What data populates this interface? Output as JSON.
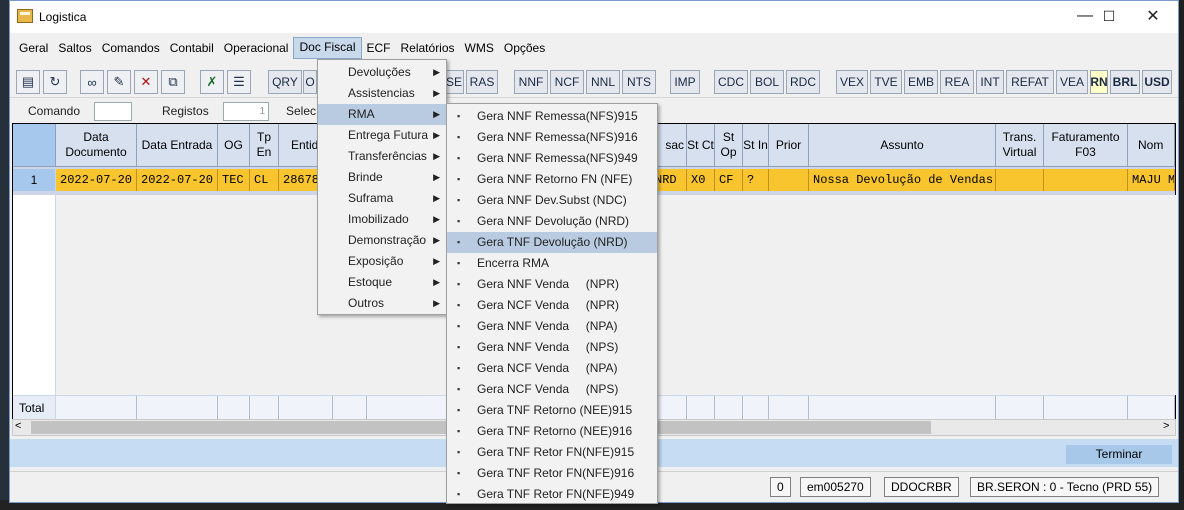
{
  "window": {
    "title": "Logistica",
    "minimize": "—",
    "maximize": "☐",
    "close": "✕"
  },
  "menubar": [
    "Geral",
    "Saltos",
    "Comandos",
    "Contabil",
    "Operacional",
    "Doc Fiscal",
    "ECF",
    "Relatórios",
    "WMS",
    "Opções"
  ],
  "toolbar": {
    "icons": [
      "folder-filter-icon",
      "refresh-icon",
      "glasses-icon",
      "edit-icon",
      "delete-icon",
      "copy-icon",
      "excel-icon",
      "report-icon"
    ],
    "buttons": [
      "QRY",
      "O",
      "SE",
      "RAS",
      "NNF",
      "NCF",
      "NNL",
      "NTS",
      "IMP",
      "CDC",
      "BOL",
      "RDC",
      "VEX",
      "TVE",
      "EMB",
      "REA",
      "INT",
      "REFAT",
      "VEA",
      "RN",
      "BRL",
      "USD"
    ]
  },
  "command_row": {
    "comando_label": "Comando",
    "registos_label": "Registos",
    "registos_value": "1",
    "selec_label": "Selec"
  },
  "grid": {
    "headers": {
      "data_documento": "Data Documento",
      "data_entrada": "Data Entrada",
      "og": "OG",
      "tp_en": "Tp En",
      "entidade": "Entid",
      "sac": "sac",
      "st_ct": "St Ct",
      "st_op": "St Op",
      "st_in": "St In",
      "prior": "Prior",
      "assunto": "Assunto",
      "trans_virtual": "Trans. Virtual",
      "faturamento": "Faturamento F03",
      "nome": "Nom"
    },
    "row": {
      "num": "1",
      "data_documento": "2022-07-20",
      "data_entrada": "2022-07-20",
      "og": "TEC",
      "tp_en": "CL",
      "entidade": "28678",
      "sac": "NRD",
      "st_ct": "X0",
      "st_op": "CF",
      "st_in": "?",
      "prior": "",
      "assunto": "Nossa Devolução de Vendas",
      "trans_virtual": "",
      "faturamento": "",
      "nome": "MAJU M"
    },
    "total_label": "Total"
  },
  "bottom": {
    "terminar": "Terminar"
  },
  "status": {
    "zero": "0",
    "user": "em005270",
    "code": "DDOCRBR",
    "server": "BR.SERON : 0 - Tecno (PRD 55)"
  },
  "doc_fiscal_menu": [
    "Devoluções",
    "Assistencias",
    "RMA",
    "Entrega Futura",
    "Transferências",
    "Brinde",
    "Suframa",
    "Imobilizado",
    "Demonstração",
    "Exposição",
    "Estoque",
    "Outros"
  ],
  "rma_submenu": [
    "Gera NNF Remessa(NFS)915",
    "Gera NNF Remessa(NFS)916",
    "Gera NNF Remessa(NFS)949",
    "Gera NNF Retorno FN (NFE)",
    "Gera NNF Dev.Subst (NDC)",
    "Gera NNF Devolução (NRD)",
    "Gera TNF Devolução (NRD)",
    "Encerra RMA",
    "Gera NNF Venda     (NPR)",
    "Gera NCF Venda     (NPR)",
    "Gera NNF Venda     (NPA)",
    "Gera NNF Venda     (NPS)",
    "Gera NCF Venda     (NPA)",
    "Gera NCF Venda     (NPS)",
    "Gera TNF Retorno (NEE)915",
    "Gera TNF Retorno (NEE)916",
    "Gera TNF Retor FN(NFE)915",
    "Gera TNF Retor FN(NFE)916",
    "Gera TNF Retor FN(NFE)949"
  ],
  "colors": {
    "selected_row": "#f8c52e",
    "header": "#d6e0ef",
    "menu_highlight": "#b8cbe0"
  }
}
